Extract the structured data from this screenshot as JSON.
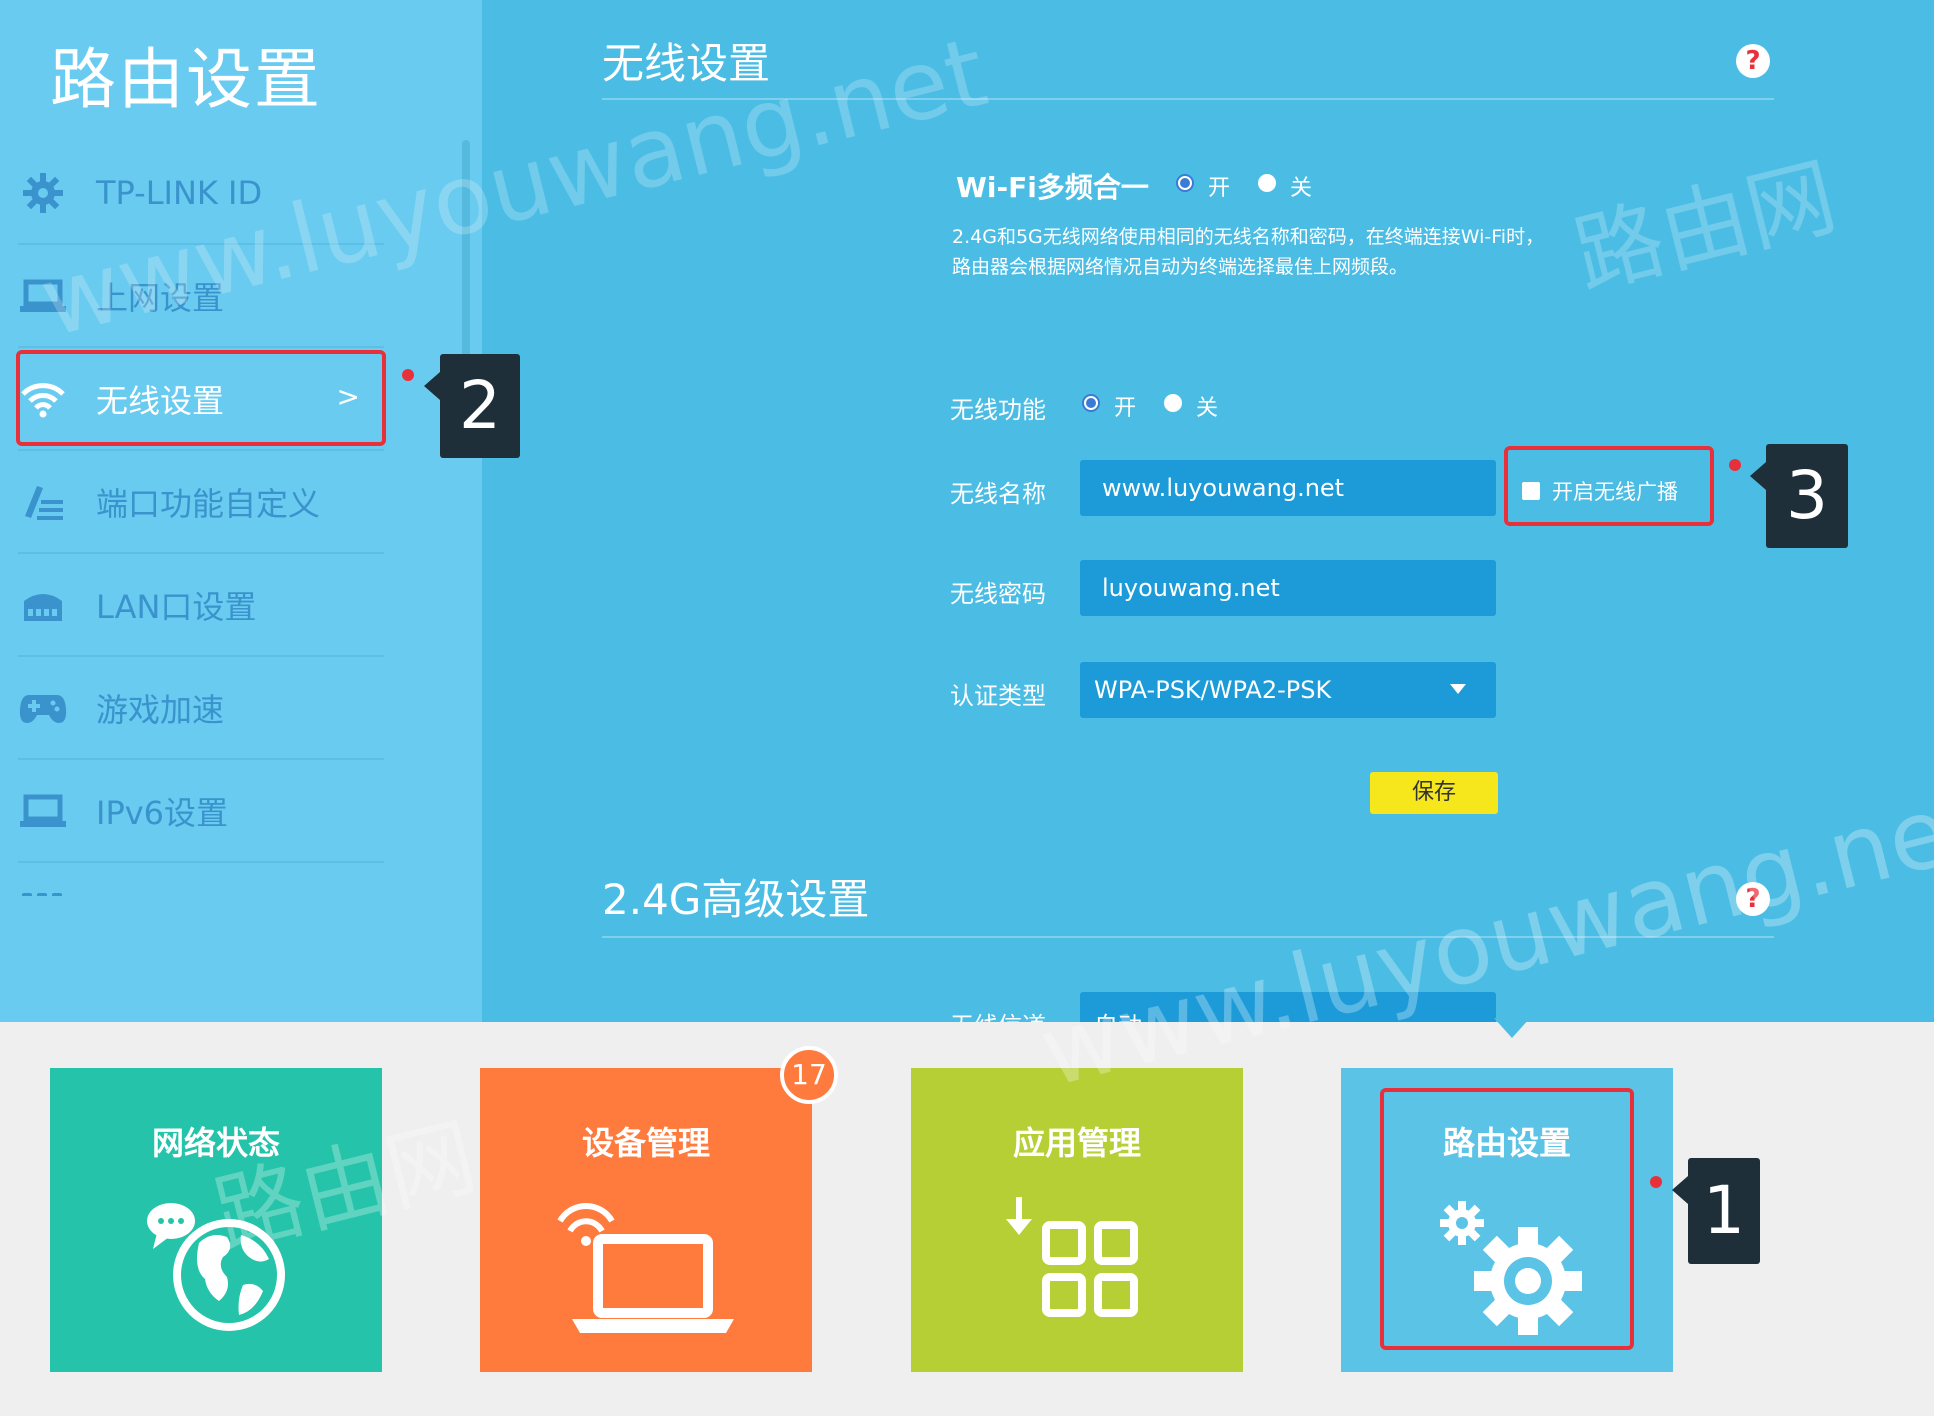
{
  "sidebar": {
    "title": "路由设置",
    "items": [
      {
        "label": "TP-LINK ID",
        "icon": "gear-icon"
      },
      {
        "label": "上网设置",
        "icon": "laptop-icon"
      },
      {
        "label": "无线设置",
        "icon": "wifi-icon",
        "active": true,
        "chevron": ">"
      },
      {
        "label": "端口功能自定义",
        "icon": "pencil-list-icon"
      },
      {
        "label": "LAN口设置",
        "icon": "switch-icon"
      },
      {
        "label": "游戏加速",
        "icon": "gamepad-icon"
      },
      {
        "label": "IPv6设置",
        "icon": "laptop-icon"
      }
    ]
  },
  "wireless": {
    "title": "无线设置",
    "help": "?",
    "multi_band": {
      "label": "Wi-Fi多频合一",
      "on": "开",
      "off": "关",
      "selected": "开"
    },
    "description_line1": "2.4G和5G无线网络使用相同的无线名称和密码，在终端连接Wi-Fi时，",
    "description_line2": "路由器会根据网络情况自动为终端选择最佳上网频段。",
    "function": {
      "label": "无线功能",
      "on": "开",
      "off": "关",
      "selected": "开"
    },
    "ssid": {
      "label": "无线名称",
      "value": "www.luyouwang.net"
    },
    "broadcast_label": "开启无线广播",
    "password": {
      "label": "无线密码",
      "value": "luyouwang.net"
    },
    "auth": {
      "label": "认证类型",
      "value": "WPA-PSK/WPA2-PSK"
    },
    "save": "保存"
  },
  "advanced": {
    "title": "2.4G高级设置",
    "help": "?",
    "channel_label": "无线信道",
    "channel_value": "自动"
  },
  "tiles": [
    {
      "label": "网络状态",
      "icon": "globe-icon",
      "color": "#24c3aa"
    },
    {
      "label": "设备管理",
      "icon": "laptop-wifi-icon",
      "color": "#ff7a3d",
      "badge": "17"
    },
    {
      "label": "应用管理",
      "icon": "apps-grid-icon",
      "color": "#b5cf35"
    },
    {
      "label": "路由设置",
      "icon": "gears-icon",
      "color": "#5bc3e6"
    }
  ],
  "callouts": [
    "1",
    "2",
    "3"
  ],
  "watermark": {
    "url": "www.luyouwang.net",
    "cn": "路由网"
  },
  "colors": {
    "panel": "#4bbde4",
    "sidebar": "#69cbef",
    "field": "#1c9bd8",
    "highlight": "#e8303a",
    "save": "#f6e61c"
  }
}
